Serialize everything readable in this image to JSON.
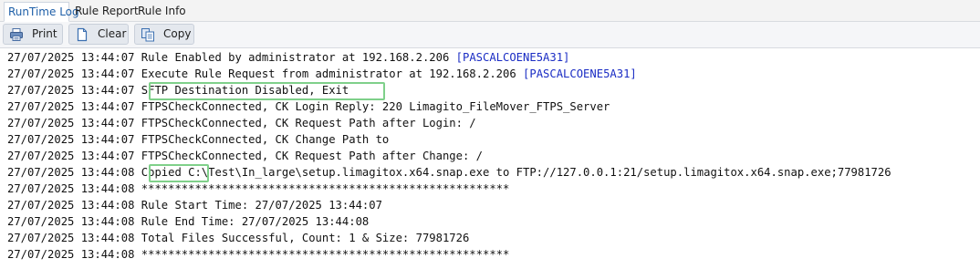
{
  "tabs": [
    {
      "label": "RunTime Log",
      "active": true
    },
    {
      "label": "Rule Report",
      "active": false
    },
    {
      "label": "Rule Info",
      "active": false
    }
  ],
  "toolbar": {
    "print_label": "Print",
    "clear_label": "Clear",
    "copy_label": "Copy",
    "print_icon": "printer-icon",
    "clear_icon": "document-icon",
    "copy_icon": "copy-icon"
  },
  "log": {
    "lines": [
      {
        "ts": "27/07/2025 13:44:07",
        "msg": "Rule Enabled by administrator at 192.168.2.206 ",
        "host": "[PASCALCOENE5A31]"
      },
      {
        "ts": "27/07/2025 13:44:07",
        "msg": "Execute Rule Request from administrator at 192.168.2.206 ",
        "host": "[PASCALCOENE5A31]"
      },
      {
        "ts": "27/07/2025 13:44:07",
        "msg": "SFTP Destination Disabled, Exit",
        "host": ""
      },
      {
        "ts": "27/07/2025 13:44:07",
        "msg": "FTPSCheckConnected, CK Login Reply: 220 Limagito_FileMover_FTPS_Server",
        "host": ""
      },
      {
        "ts": "27/07/2025 13:44:07",
        "msg": "FTPSCheckConnected, CK Request Path after Login: /",
        "host": ""
      },
      {
        "ts": "27/07/2025 13:44:07",
        "msg": "FTPSCheckConnected, CK Change Path to",
        "host": ""
      },
      {
        "ts": "27/07/2025 13:44:07",
        "msg": "FTPSCheckConnected, CK Request Path after Change: /",
        "host": ""
      },
      {
        "ts": "27/07/2025 13:44:08",
        "msg": "Copied C:\\Test\\In_large\\setup.limagitox.x64.snap.exe to FTP://127.0.0.1:21/setup.limagitox.x64.snap.exe;77981726",
        "host": ""
      },
      {
        "ts": "27/07/2025 13:44:08",
        "msg": "*******************************************************",
        "host": ""
      },
      {
        "ts": "27/07/2025 13:44:08",
        "msg": "Rule Start Time: 27/07/2025 13:44:07",
        "host": ""
      },
      {
        "ts": "27/07/2025 13:44:08",
        "msg": "Rule End Time: 27/07/2025 13:44:08",
        "host": ""
      },
      {
        "ts": "27/07/2025 13:44:08",
        "msg": "Total Files Successful, Count: 1 & Size: 77981726",
        "host": ""
      },
      {
        "ts": "27/07/2025 13:44:08",
        "msg": "*******************************************************",
        "host": ""
      }
    ]
  },
  "colors": {
    "highlight_border": "#7fd08a",
    "host_text": "#1a2cc4",
    "active_tab_text": "#1e5fa8"
  }
}
